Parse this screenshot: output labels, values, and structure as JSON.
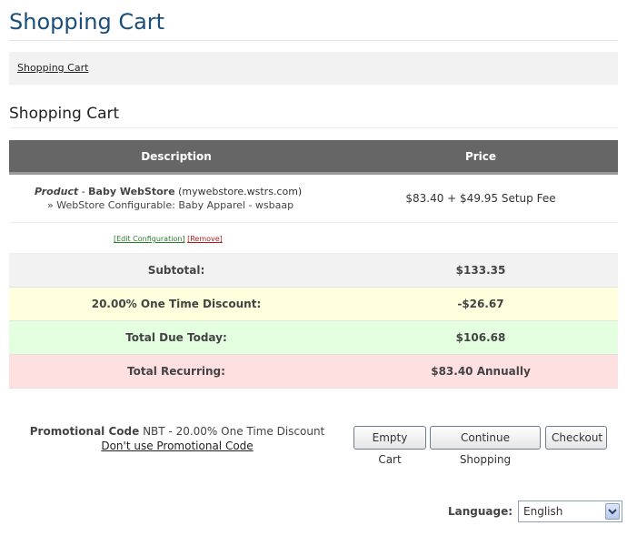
{
  "page": {
    "title": "Shopping Cart",
    "breadcrumb": "Shopping Cart",
    "section_title": "Shopping Cart"
  },
  "cart": {
    "headers": {
      "description": "Description",
      "price": "Price"
    },
    "item": {
      "type": "Product",
      "separator": " - ",
      "name": "Baby WebStore",
      "domain": "(mywebstore.wstrs.com)",
      "config": "» WebStore Configurable: Baby Apparel - wsbaap",
      "price": "$83.40 + $49.95 Setup Fee",
      "edit_label": "[Edit Configuration]",
      "remove_label": "[Remove]"
    },
    "subtotal": {
      "label": "Subtotal:",
      "value": "$133.35"
    },
    "discount": {
      "label": "20.00% One Time Discount:",
      "value": "-$26.67"
    },
    "total_today": {
      "label": "Total Due Today:",
      "value": "$106.68"
    },
    "recurring": {
      "label": "Total Recurring:",
      "value": "$83.40 Annually"
    }
  },
  "promo": {
    "label": "Promotional Code",
    "value": "NBT - 20.00% One Time Discount",
    "remove_label": "Don't use Promotional Code"
  },
  "buttons": {
    "empty": "Empty Cart",
    "continue": "Continue Shopping",
    "checkout": "Checkout"
  },
  "language": {
    "label": "Language:",
    "selected": "English",
    "arrow_icon": "chevron-down-icon"
  },
  "colors": {
    "title_blue": "#1b4f7a",
    "header_gray": "#666666",
    "discount_bg": "#ffffdd",
    "today_bg": "#e4ffe0",
    "recurring_bg": "#ffe0e0"
  }
}
